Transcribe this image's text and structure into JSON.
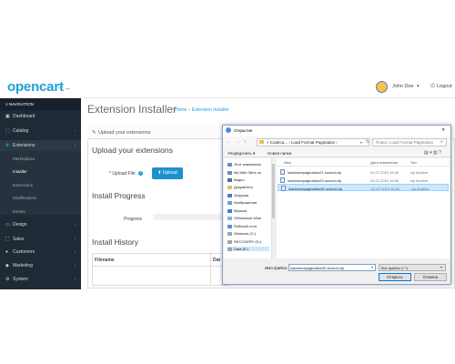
{
  "header": {
    "logo": "opencart",
    "logo_cart": "·ᵕ→",
    "user_name": "John Doe",
    "user_caret": "▾",
    "logout": "Logout"
  },
  "sidebar": {
    "title": "≡ NAVIGATION",
    "items": [
      {
        "icon": "▣",
        "label": "Dashboard"
      },
      {
        "icon": "⬚",
        "label": "Catalog",
        "chevron": "›"
      },
      {
        "icon": "✚",
        "label": "Extensions",
        "chevron": "›"
      },
      {
        "label": "Marketplace"
      },
      {
        "label": "Installer"
      },
      {
        "label": "Extensions"
      },
      {
        "label": "Modifications"
      },
      {
        "label": "Events"
      },
      {
        "icon": "▭",
        "label": "Design",
        "chevron": "›"
      },
      {
        "icon": "⛶",
        "label": "Sales",
        "chevron": "›"
      },
      {
        "icon": "●",
        "label": "Customers",
        "chevron": "›"
      },
      {
        "icon": "◆",
        "label": "Marketing",
        "chevron": "›"
      },
      {
        "icon": "⚙",
        "label": "System",
        "chevron": "›"
      }
    ]
  },
  "main": {
    "title": "Extension Installer",
    "breadcrumb_home": "Home",
    "breadcrumb_sep": "»",
    "breadcrumb_current": "Extension Installer",
    "panel_title": "Upload your extensions",
    "upload_heading": "Upload your extensions",
    "upload_label": "* Upload File",
    "upload_button": "⬆ Upload",
    "install_progress": "Install Progress",
    "progress_label": "Progress",
    "install_history": "Install History",
    "col_filename": "Filename",
    "col_date": "Dat"
  },
  "dialog": {
    "title": "Открытие",
    "close": "✕",
    "nav_back": "←",
    "nav_forward": "→",
    "nav_up": "↑",
    "path": "«  Codeca...  ›  Load Format Pagination  ›",
    "search_placeholder": "Поиск: Load Format Pagination",
    "organize": "Упорядочить ▾",
    "new_folder": "Новая папка",
    "tree": [
      {
        "label": "Этот компьютер",
        "color": "#6a8fc7"
      },
      {
        "label": "My Web Sites on",
        "color": "#6a8fc7"
      },
      {
        "label": "Видео",
        "color": "#4a6fa8"
      },
      {
        "label": "Документы",
        "color": "#e6c055"
      },
      {
        "label": "Загрузки",
        "color": "#3a82d1"
      },
      {
        "label": "Изображения",
        "color": "#5fa4d9"
      },
      {
        "label": "Музыка",
        "color": "#3a82d1"
      },
      {
        "label": "Объемные объе",
        "color": "#7fb5e6"
      },
      {
        "label": "Рабочий стол",
        "color": "#5b8fd0"
      },
      {
        "label": "Windows (C:)",
        "color": "#9aa5b1"
      },
      {
        "label": "RECOVERY (D:)",
        "color": "#9aa5b1"
      },
      {
        "label": "Data (E:)",
        "color": "#9aa5b1"
      }
    ],
    "columns": {
      "name": "Имя",
      "date": "Дата изменения",
      "type": "Тип"
    },
    "files": [
      {
        "name": "loadmorepagination21.ocmod.zip",
        "date": "01.07.2019 16:49",
        "type": "zip Archive"
      },
      {
        "name": "loadmorepagination23.ocmod.zip",
        "date": "01.07.2019 16:50",
        "type": "zip Archive"
      },
      {
        "name": "loadmorepagination30.ocmod.zip",
        "date": "01.07.2019 16:51",
        "type": "zip Archive"
      }
    ],
    "filename_label": "Имя файла:",
    "filename_value": "loadmorepagination30.ocmod.zip",
    "filetype_value": "Все файлы (*.*)",
    "open_button": "Открыть",
    "cancel_button": "Отмена"
  },
  "colors": {
    "brand": "#1d9fd8",
    "sidebar": "#1e2a35",
    "button": "#1e91cf",
    "selection": "#cce8ff"
  }
}
